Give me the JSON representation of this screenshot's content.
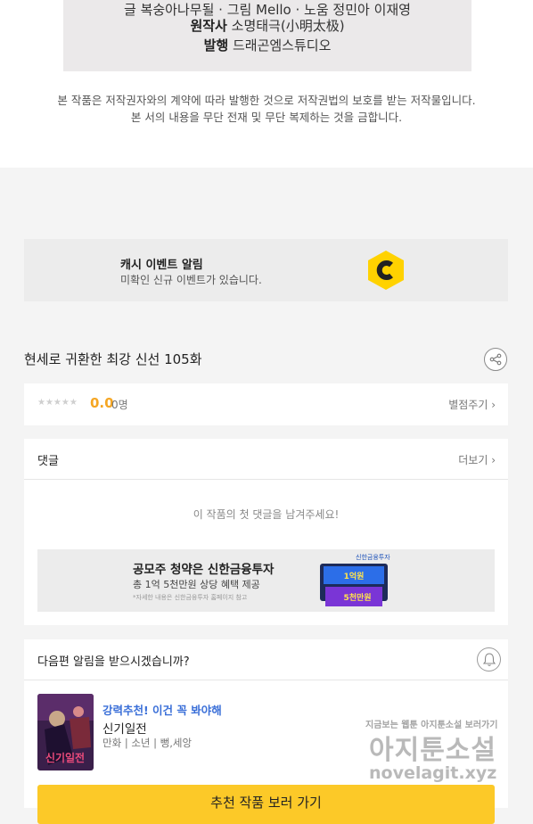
{
  "credits": {
    "line1": "글 복숭아나무될 · 그림 Mello · 노움 정민아 이재영",
    "author_label": "원작사",
    "author_value": "소명태극(小明太极)",
    "publisher_label": "발행",
    "publisher_value": "드래곤엠스튜디오"
  },
  "copyright_notice": {
    "line1": "본 작품은 저작권자와의 계약에 따라 발행한 것으로 저작권법의 보호를 받는 저작물입니다.",
    "line2": "본 서의 내용을 무단 전재 및 무단 복제하는 것을 금합니다."
  },
  "cash_event": {
    "title": "캐시 이벤트 알림",
    "subtitle": "미확인 신규 이벤트가 있습니다.",
    "icon": "cash-c-icon",
    "icon_color": "#ffd200"
  },
  "work": {
    "title": "현세로 귀환한 최강 신선 105화",
    "share_icon": "share-icon"
  },
  "rating": {
    "stars": "★★★★★",
    "score": "0.0",
    "count": "0명",
    "rate_link": "별점주기 ›"
  },
  "comments": {
    "title": "댓글",
    "more": "더보기 ›",
    "empty_message": "이 작품의 첫 댓글을 남겨주세요!"
  },
  "ad": {
    "title": "공모주 청약은 신한금융투자",
    "subtitle": "총 1억 5천만원 상당 혜택 제공",
    "fine_print": "*자세한 내용은 신한금융투자 홈페이지 참고",
    "brand": "신한금융투자",
    "badge_top": "1억원",
    "badge_bottom": "5천만원"
  },
  "notify": {
    "question": "다음편 알림을 받으시겠습니까?",
    "bell_icon": "bell-icon"
  },
  "recommendation": {
    "tag": "강력추천! 이건 꼭 봐야해",
    "title": "신기일전",
    "meta": "만화 | 소년 | 뻥,세앙",
    "thumb_label": "신기일전",
    "button": "추천 작품 보러 가기"
  },
  "watermark": {
    "line1": "지금보는 웹툰 아지툰소설 보러가기",
    "line2": "아지툰소설",
    "line3": "novelagit.xyz"
  },
  "colors": {
    "accent_yellow": "#fcc928",
    "score_orange": "#f5a623",
    "link_blue": "#3a6fd8"
  }
}
